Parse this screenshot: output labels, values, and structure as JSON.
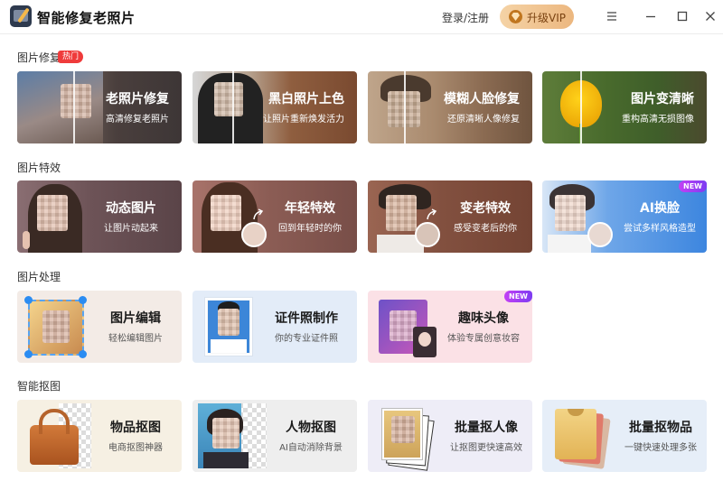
{
  "app": {
    "title": "智能修复老照片"
  },
  "header": {
    "login_label": "登录/注册",
    "vip_label": "升级VIP",
    "icons": [
      "menu-icon",
      "minimize-icon",
      "maximize-icon",
      "close-icon"
    ]
  },
  "sections": [
    {
      "label": "图片修复",
      "badge": "热门",
      "cards": [
        {
          "title": "老照片修复",
          "subtitle": "高清修复老照片"
        },
        {
          "title": "黑白照片上色",
          "subtitle": "让照片重新焕发活力"
        },
        {
          "title": "模糊人脸修复",
          "subtitle": "还原清晰人像修复"
        },
        {
          "title": "图片变清晰",
          "subtitle": "重构高清无损图像"
        }
      ]
    },
    {
      "label": "图片特效",
      "cards": [
        {
          "title": "动态图片",
          "subtitle": "让图片动起来"
        },
        {
          "title": "年轻特效",
          "subtitle": "回到年轻时的你"
        },
        {
          "title": "变老特效",
          "subtitle": "感受变老后的你"
        },
        {
          "title": "AI换脸",
          "subtitle": "尝试多样风格造型",
          "badge": "NEW"
        }
      ]
    },
    {
      "label": "图片处理",
      "cards": [
        {
          "title": "图片编辑",
          "subtitle": "轻松编辑图片"
        },
        {
          "title": "证件照制作",
          "subtitle": "你的专业证件照"
        },
        {
          "title": "趣味头像",
          "subtitle": "体验专属创意妆容",
          "badge": "NEW"
        }
      ]
    },
    {
      "label": "智能抠图",
      "cards": [
        {
          "title": "物品抠图",
          "subtitle": "电商抠图神器"
        },
        {
          "title": "人物抠图",
          "subtitle": "AI自动消除背景"
        },
        {
          "title": "批量抠人像",
          "subtitle": "让抠图更快速高效"
        },
        {
          "title": "批量抠物品",
          "subtitle": "一键快速处理多张"
        }
      ]
    }
  ],
  "colors": {
    "vip_gradient_start": "#f5d3a6",
    "vip_gradient_end": "#ecb77f",
    "hot_badge": "#ef3b3b",
    "new_badge": "#b43ff3"
  }
}
